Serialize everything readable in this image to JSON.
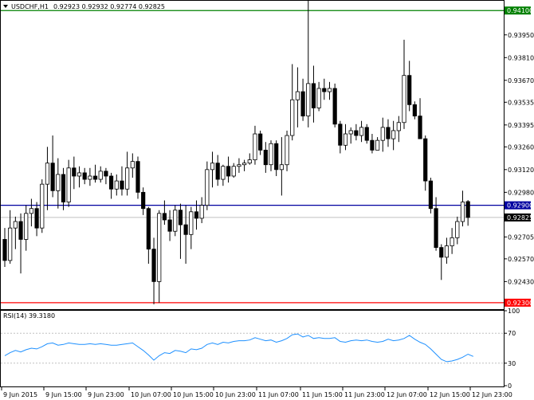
{
  "header": {
    "symbol": "USDCHF,H1",
    "ohlc": "0.92923 0.92932 0.92774 0.92825"
  },
  "rsi": {
    "label": "RSI(14) 39.3180",
    "axis_labels": [
      "100",
      "70",
      "30",
      "0"
    ],
    "levels": [
      100,
      70,
      30,
      0
    ],
    "line_color": "#1e90ff"
  },
  "chart_data": {
    "type": "candlestick",
    "symbol": "USDCHF",
    "timeframe": "H1",
    "price_ticks": [
      "0.93950",
      "0.93810",
      "0.93670",
      "0.93535",
      "0.93395",
      "0.93260",
      "0.93120",
      "0.92980",
      "0.92705",
      "0.92570",
      "0.92430"
    ],
    "ylim": [
      0.9229,
      0.941
    ],
    "levels": [
      {
        "price": 0.941,
        "label": "0.94100",
        "color": "#008000"
      },
      {
        "price": 0.929,
        "label": "0.92900",
        "color": "#0000a0"
      },
      {
        "price": 0.923,
        "label": "0.92300",
        "color": "#ff0000"
      }
    ],
    "current_price": {
      "price": 0.92825,
      "label": "0.92825",
      "color": "#c0c0c0"
    },
    "time_labels": [
      "9 Jun 2015",
      "9 Jun 15:00",
      "9 Jun 23:00",
      "10 Jun 07:00",
      "10 Jun 15:00",
      "10 Jun 23:00",
      "11 Jun 07:00",
      "11 Jun 15:00",
      "11 Jun 23:00",
      "12 Jun 07:00",
      "12 Jun 15:00",
      "12 Jun 23:00"
    ],
    "candles_ohlc": [
      [
        0.9269,
        0.9276,
        0.9252,
        0.9256
      ],
      [
        0.9256,
        0.9287,
        0.9254,
        0.9276
      ],
      [
        0.9276,
        0.9283,
        0.9263,
        0.928
      ],
      [
        0.928,
        0.9285,
        0.9248,
        0.9269
      ],
      [
        0.9269,
        0.929,
        0.9262,
        0.9285
      ],
      [
        0.9285,
        0.9294,
        0.9277,
        0.9288
      ],
      [
        0.9288,
        0.9292,
        0.9271,
        0.9276
      ],
      [
        0.9276,
        0.9306,
        0.9273,
        0.9303
      ],
      [
        0.9303,
        0.9326,
        0.9287,
        0.9316
      ],
      [
        0.9316,
        0.9333,
        0.9295,
        0.9299
      ],
      [
        0.9299,
        0.9319,
        0.9288,
        0.9309
      ],
      [
        0.9309,
        0.9313,
        0.9287,
        0.9292
      ],
      [
        0.9292,
        0.9318,
        0.9289,
        0.9313
      ],
      [
        0.9313,
        0.932,
        0.93,
        0.9308
      ],
      [
        0.9308,
        0.9314,
        0.9301,
        0.931
      ],
      [
        0.931,
        0.9313,
        0.9303,
        0.9306
      ],
      [
        0.9306,
        0.9313,
        0.9302,
        0.9308
      ],
      [
        0.9308,
        0.9315,
        0.9304,
        0.9306
      ],
      [
        0.9306,
        0.9314,
        0.9304,
        0.9311
      ],
      [
        0.9311,
        0.9313,
        0.9303,
        0.9308
      ],
      [
        0.9308,
        0.931,
        0.9294,
        0.93
      ],
      [
        0.93,
        0.9309,
        0.9296,
        0.9305
      ],
      [
        0.9305,
        0.9314,
        0.9296,
        0.93
      ],
      [
        0.93,
        0.9323,
        0.9296,
        0.9313
      ],
      [
        0.9313,
        0.9322,
        0.9307,
        0.9317
      ],
      [
        0.9317,
        0.932,
        0.9294,
        0.9298
      ],
      [
        0.9298,
        0.9301,
        0.9284,
        0.9288
      ],
      [
        0.9288,
        0.9289,
        0.9254,
        0.9263
      ],
      [
        0.9263,
        0.927,
        0.9229,
        0.9243
      ],
      [
        0.9243,
        0.9287,
        0.923,
        0.9285
      ],
      [
        0.9285,
        0.9293,
        0.9278,
        0.9281
      ],
      [
        0.9281,
        0.9287,
        0.9268,
        0.9274
      ],
      [
        0.9274,
        0.929,
        0.9271,
        0.9287
      ],
      [
        0.9287,
        0.9291,
        0.9257,
        0.9278
      ],
      [
        0.9278,
        0.929,
        0.9254,
        0.9272
      ],
      [
        0.9272,
        0.9289,
        0.9263,
        0.9286
      ],
      [
        0.9286,
        0.9293,
        0.9275,
        0.9282
      ],
      [
        0.9282,
        0.9295,
        0.9279,
        0.929
      ],
      [
        0.929,
        0.9317,
        0.9287,
        0.9312
      ],
      [
        0.9312,
        0.9323,
        0.9301,
        0.9316
      ],
      [
        0.9316,
        0.9321,
        0.9302,
        0.9306
      ],
      [
        0.9306,
        0.9315,
        0.9302,
        0.9314
      ],
      [
        0.9314,
        0.932,
        0.9304,
        0.9308
      ],
      [
        0.9308,
        0.9316,
        0.9307,
        0.9314
      ],
      [
        0.9314,
        0.9319,
        0.931,
        0.9315
      ],
      [
        0.9315,
        0.9318,
        0.9311,
        0.9316
      ],
      [
        0.9316,
        0.9322,
        0.9315,
        0.9318
      ],
      [
        0.9318,
        0.9339,
        0.9315,
        0.9334
      ],
      [
        0.9334,
        0.9336,
        0.9321,
        0.9324
      ],
      [
        0.9324,
        0.9329,
        0.931,
        0.9315
      ],
      [
        0.9315,
        0.933,
        0.9311,
        0.9328
      ],
      [
        0.9328,
        0.933,
        0.9308,
        0.9312
      ],
      [
        0.9312,
        0.9332,
        0.9296,
        0.9315
      ],
      [
        0.9315,
        0.9336,
        0.9311,
        0.9333
      ],
      [
        0.9333,
        0.9377,
        0.933,
        0.9355
      ],
      [
        0.9355,
        0.9375,
        0.9338,
        0.936
      ],
      [
        0.936,
        0.9368,
        0.9342,
        0.9345
      ],
      [
        0.9345,
        0.9418,
        0.9338,
        0.9365
      ],
      [
        0.9365,
        0.9376,
        0.9341,
        0.935
      ],
      [
        0.935,
        0.9366,
        0.9348,
        0.9362
      ],
      [
        0.9362,
        0.9368,
        0.9355,
        0.936
      ],
      [
        0.936,
        0.9366,
        0.9355,
        0.9362
      ],
      [
        0.9362,
        0.9365,
        0.9338,
        0.934
      ],
      [
        0.934,
        0.9342,
        0.9322,
        0.9327
      ],
      [
        0.9327,
        0.934,
        0.9324,
        0.9334
      ],
      [
        0.9334,
        0.9338,
        0.9328,
        0.9336
      ],
      [
        0.9336,
        0.934,
        0.933,
        0.9333
      ],
      [
        0.9333,
        0.9342,
        0.9329,
        0.9338
      ],
      [
        0.9338,
        0.934,
        0.9328,
        0.933
      ],
      [
        0.933,
        0.9334,
        0.9322,
        0.9324
      ],
      [
        0.9324,
        0.9332,
        0.9324,
        0.933
      ],
      [
        0.933,
        0.9344,
        0.9323,
        0.9338
      ],
      [
        0.9338,
        0.9343,
        0.9326,
        0.9331
      ],
      [
        0.9331,
        0.9342,
        0.9324,
        0.9336
      ],
      [
        0.9336,
        0.9345,
        0.9329,
        0.9341
      ],
      [
        0.9341,
        0.9392,
        0.9337,
        0.937
      ],
      [
        0.937,
        0.9379,
        0.9348,
        0.9352
      ],
      [
        0.9352,
        0.9354,
        0.9343,
        0.9345
      ],
      [
        0.9345,
        0.9356,
        0.9339,
        0.9331
      ],
      [
        0.9331,
        0.9333,
        0.9299,
        0.9305
      ],
      [
        0.9305,
        0.9307,
        0.9285,
        0.9288
      ],
      [
        0.9288,
        0.9295,
        0.9262,
        0.9264
      ],
      [
        0.9264,
        0.9266,
        0.9244,
        0.9258
      ],
      [
        0.9258,
        0.927,
        0.9254,
        0.9265
      ],
      [
        0.9265,
        0.9276,
        0.926,
        0.927
      ],
      [
        0.927,
        0.9283,
        0.9266,
        0.928
      ],
      [
        0.928,
        0.9299,
        0.9277,
        0.9292
      ],
      [
        0.92923,
        0.92932,
        0.92774,
        0.92825
      ]
    ],
    "rsi_values": [
      40,
      44,
      47,
      45,
      48,
      50,
      49,
      52,
      56,
      57,
      54,
      55,
      57,
      56,
      55,
      55,
      56,
      55,
      56,
      55,
      54,
      54,
      55,
      56,
      57,
      52,
      47,
      41,
      34,
      40,
      44,
      43,
      47,
      46,
      44,
      49,
      48,
      50,
      55,
      57,
      55,
      58,
      57,
      59,
      60,
      60,
      61,
      64,
      62,
      60,
      61,
      58,
      60,
      63,
      68,
      69,
      65,
      67,
      63,
      64,
      63,
      63,
      64,
      59,
      58,
      60,
      61,
      60,
      61,
      59,
      58,
      59,
      62,
      60,
      61,
      63,
      67,
      62,
      58,
      55,
      49,
      42,
      35,
      32,
      33,
      35,
      38,
      42,
      39
    ]
  }
}
